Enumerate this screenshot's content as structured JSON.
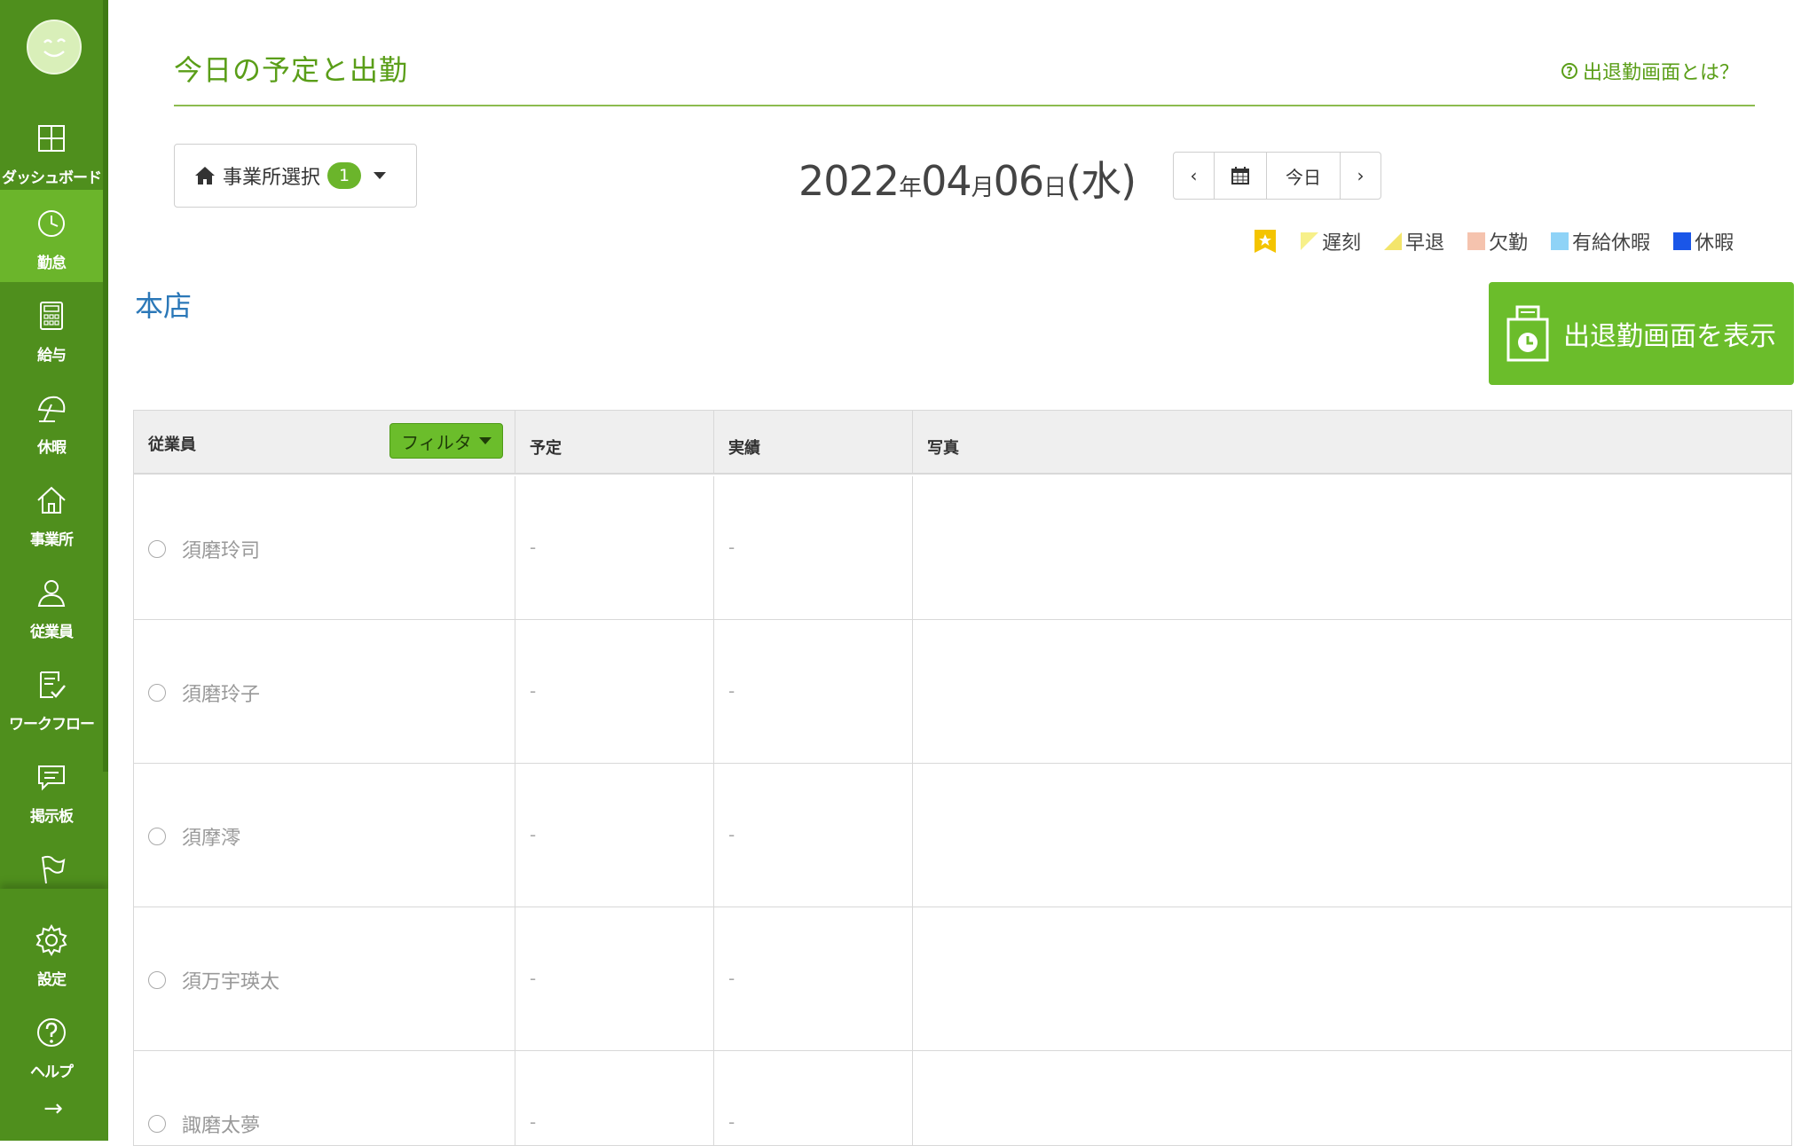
{
  "sidebar": {
    "items": [
      {
        "label": "ダッシュボード",
        "icon": "dashboard-icon"
      },
      {
        "label": "勤怠",
        "icon": "clock-icon"
      },
      {
        "label": "給与",
        "icon": "calculator-icon"
      },
      {
        "label": "休暇",
        "icon": "umbrella-icon"
      },
      {
        "label": "事業所",
        "icon": "home-icon"
      },
      {
        "label": "従業員",
        "icon": "user-icon"
      },
      {
        "label": "ワークフロー",
        "icon": "checklist-icon"
      },
      {
        "label": "掲示板",
        "icon": "message-icon"
      }
    ],
    "bottom_items": [
      {
        "label": "設定",
        "icon": "gear-icon"
      },
      {
        "label": "ヘルプ",
        "icon": "help-icon"
      }
    ],
    "collapse_icon": "→",
    "active_index": 1
  },
  "header": {
    "title": "今日の予定と出勤",
    "help_link": "出退勤画面とは？",
    "help_icon": "?"
  },
  "office_select": {
    "label": "事業所選択",
    "count": "1"
  },
  "date": {
    "year": "2022",
    "year_unit": "年",
    "month": "04",
    "month_unit": "月",
    "day": "06",
    "day_unit": "日",
    "weekday": "(水)"
  },
  "date_nav": {
    "prev": "‹",
    "today": "今日",
    "next": "›"
  },
  "legend": {
    "items": [
      {
        "label": "遅刻",
        "color": "#f7f08a"
      },
      {
        "label": "早退",
        "color": "#f3e56b"
      },
      {
        "label": "欠勤",
        "color": "#f5c3ae"
      },
      {
        "label": "有給休暇",
        "color": "#8fd3f7"
      },
      {
        "label": "休暇",
        "color": "#1a56e8"
      }
    ],
    "star_color": "#f4c400"
  },
  "section": {
    "title": "本店",
    "show_button": "出退勤画面を表示"
  },
  "table": {
    "headers": {
      "employee": "従業員",
      "filter": "フィルタ",
      "schedule": "予定",
      "actual": "実績",
      "photo": "写真"
    },
    "rows": [
      {
        "name": "須磨玲司",
        "schedule": "-",
        "actual": "-"
      },
      {
        "name": "須磨玲子",
        "schedule": "-",
        "actual": "-"
      },
      {
        "name": "須摩澪",
        "schedule": "-",
        "actual": "-"
      },
      {
        "name": "須万宇瑛太",
        "schedule": "-",
        "actual": "-"
      },
      {
        "name": "諏磨太夢",
        "schedule": "-",
        "actual": "-"
      }
    ]
  },
  "colors": {
    "sidebar": "#4f8f1d",
    "sidebar_active": "#6bb52b",
    "accent_green": "#5a9e18",
    "button_green": "#6bbd2b",
    "section_blue": "#2b78b8"
  }
}
